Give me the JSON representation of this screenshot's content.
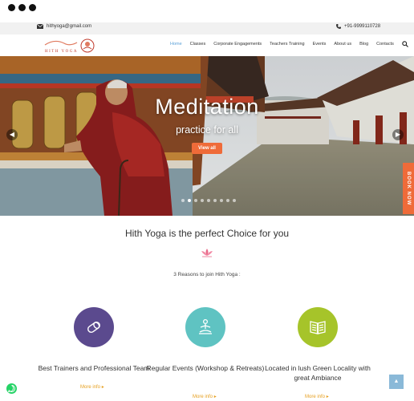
{
  "topbar": {
    "email": "hithyoga@gmail.com",
    "phone": "+91-9999110728"
  },
  "logo": {
    "text": "HITH YOGA"
  },
  "nav": {
    "items": [
      {
        "label": "Home"
      },
      {
        "label": "Classes"
      },
      {
        "label": "Corporate Engagements"
      },
      {
        "label": "Teachers Training"
      },
      {
        "label": "Events"
      },
      {
        "label": "About us"
      },
      {
        "label": "Blog"
      },
      {
        "label": "Contacts"
      }
    ],
    "active": "Home"
  },
  "hero": {
    "title": "Meditation",
    "subtitle": "practice for all",
    "button": "View all",
    "book_now": "BOOK NOW",
    "slide_count": 9,
    "active_slide": 1
  },
  "section": {
    "heading": "Hith Yoga is the perfect Choice for you",
    "subheading": "3 Reasons to join Hith Yoga :"
  },
  "features": [
    {
      "title": "Best Trainers and Professional Team",
      "more": "More info",
      "color": "#5b4a8e",
      "icon": "yoga-mat-icon"
    },
    {
      "title": "Regular Events (Workshop & Retreats)",
      "more": "More info",
      "color": "#5fc3c2",
      "icon": "meditation-person-icon"
    },
    {
      "title": "Located in lush Green Locality with great Ambiance",
      "more": "More info",
      "color": "#a6c42a",
      "icon": "book-icon"
    }
  ],
  "colors": {
    "accent": "#ef6b39",
    "active_nav": "#5aa0d8",
    "more_info": "#e6a020"
  }
}
